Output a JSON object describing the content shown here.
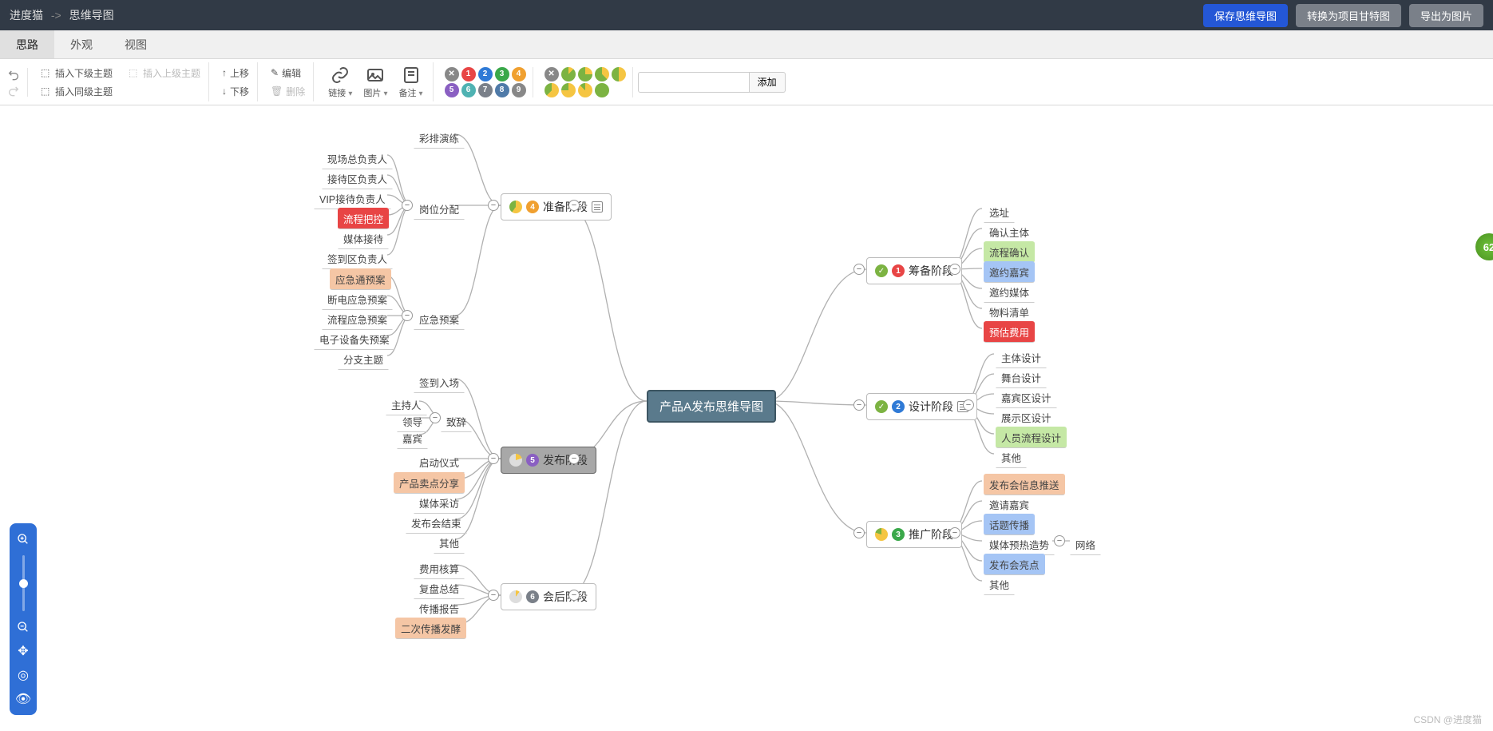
{
  "header": {
    "breadcrumb_app": "进度猫",
    "breadcrumb_page": "思维导图",
    "btn_save": "保存思维导图",
    "btn_gantt": "转换为项目甘特图",
    "btn_export": "导出为图片"
  },
  "tabs": {
    "t0": "思路",
    "t1": "外观",
    "t2": "视图"
  },
  "toolbar": {
    "insert_child": "插入下级主题",
    "insert_parent": "插入上级主题",
    "insert_sibling": "插入同级主题",
    "move_up": "上移",
    "move_down": "下移",
    "edit": "编辑",
    "delete": "删除",
    "link": "链接",
    "image": "图片",
    "note": "备注",
    "add_btn": "添加",
    "num_x": "✕",
    "priority": {
      "p1": "1",
      "p2": "2",
      "p3": "3",
      "p4": "4",
      "p5": "5",
      "p6": "6",
      "p7": "7",
      "p8": "8",
      "p9": "9"
    }
  },
  "colors": {
    "p1": "#e84545",
    "p2": "#2f7ad6",
    "p3": "#3aa84a",
    "p4": "#f0a030",
    "p5": "#8a5fc2",
    "p6": "#4fb2b2",
    "p7": "#7a8089",
    "p8": "#4f7aa8",
    "p9": "#888888"
  },
  "mindmap": {
    "root": "产品A发布思维导图",
    "phase_prepare": "准备阶段",
    "phase_prepare_num": "4",
    "phase_publish": "发布阶段",
    "phase_publish_num": "5",
    "phase_post": "会后阶段",
    "phase_post_num": "6",
    "phase_plan": "筹备阶段",
    "phase_plan_num": "1",
    "phase_design": "设计阶段",
    "phase_design_num": "2",
    "phase_promo": "推广阶段",
    "phase_promo_num": "3",
    "sub_rehearsal": "彩排演练",
    "sub_position": "岗位分配",
    "sub_emergency": "应急预案",
    "pos1": "现场总负责人",
    "pos2": "接待区负责人",
    "pos3": "VIP接待负责人",
    "pos4": "流程把控",
    "pos5": "媒体接待",
    "pos6": "签到区负责人",
    "em1": "应急通预案",
    "em2": "断电应急预案",
    "em3": "流程应急预案",
    "em4": "电子设备失预案",
    "em5": "分支主题",
    "pub_signin": "签到入场",
    "pub_speech": "致辞",
    "pub_host": "主持人",
    "pub_leader": "领导",
    "pub_guest": "嘉宾",
    "pub_ceremony": "启动仪式",
    "pub_selling": "产品卖点分享",
    "pub_media": "媒体采访",
    "pub_end": "发布会结束",
    "pub_other": "其他",
    "post_cost": "费用核算",
    "post_review": "复盘总结",
    "post_report": "传播报告",
    "post_second": "二次传播发酵",
    "plan1": "选址",
    "plan2": "确认主体",
    "plan3": "流程确认",
    "plan4": "邀约嘉宾",
    "plan5": "邀约媒体",
    "plan6": "物料清单",
    "plan7": "预估费用",
    "des1": "主体设计",
    "des2": "舞台设计",
    "des3": "嘉宾区设计",
    "des4": "展示区设计",
    "des5": "人员流程设计",
    "des6": "其他",
    "pro1": "发布会信息推送",
    "pro2": "邀请嘉宾",
    "pro3": "话题传播",
    "pro4": "媒体预热造势",
    "pro4b": "网络",
    "pro5": "发布会亮点",
    "pro6": "其他"
  },
  "zoom": {
    "score": "62"
  },
  "watermark": "CSDN @进度猫"
}
